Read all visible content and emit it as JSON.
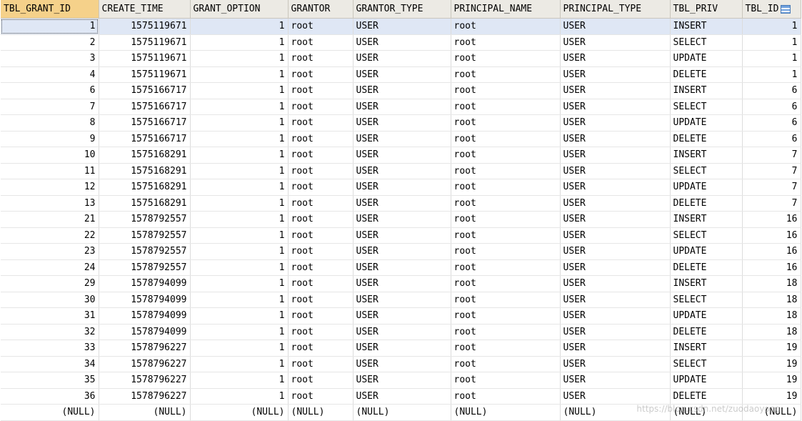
{
  "columns": [
    "TBL_GRANT_ID",
    "CREATE_TIME",
    "GRANT_OPTION",
    "GRANTOR",
    "GRANTOR_TYPE",
    "PRINCIPAL_NAME",
    "PRINCIPAL_TYPE",
    "TBL_PRIV",
    "TBL_ID"
  ],
  "rows": [
    [
      "1",
      "1575119671",
      "1",
      "root",
      "USER",
      "root",
      "USER",
      "INSERT",
      "1"
    ],
    [
      "2",
      "1575119671",
      "1",
      "root",
      "USER",
      "root",
      "USER",
      "SELECT",
      "1"
    ],
    [
      "3",
      "1575119671",
      "1",
      "root",
      "USER",
      "root",
      "USER",
      "UPDATE",
      "1"
    ],
    [
      "4",
      "1575119671",
      "1",
      "root",
      "USER",
      "root",
      "USER",
      "DELETE",
      "1"
    ],
    [
      "6",
      "1575166717",
      "1",
      "root",
      "USER",
      "root",
      "USER",
      "INSERT",
      "6"
    ],
    [
      "7",
      "1575166717",
      "1",
      "root",
      "USER",
      "root",
      "USER",
      "SELECT",
      "6"
    ],
    [
      "8",
      "1575166717",
      "1",
      "root",
      "USER",
      "root",
      "USER",
      "UPDATE",
      "6"
    ],
    [
      "9",
      "1575166717",
      "1",
      "root",
      "USER",
      "root",
      "USER",
      "DELETE",
      "6"
    ],
    [
      "10",
      "1575168291",
      "1",
      "root",
      "USER",
      "root",
      "USER",
      "INSERT",
      "7"
    ],
    [
      "11",
      "1575168291",
      "1",
      "root",
      "USER",
      "root",
      "USER",
      "SELECT",
      "7"
    ],
    [
      "12",
      "1575168291",
      "1",
      "root",
      "USER",
      "root",
      "USER",
      "UPDATE",
      "7"
    ],
    [
      "13",
      "1575168291",
      "1",
      "root",
      "USER",
      "root",
      "USER",
      "DELETE",
      "7"
    ],
    [
      "21",
      "1578792557",
      "1",
      "root",
      "USER",
      "root",
      "USER",
      "INSERT",
      "16"
    ],
    [
      "22",
      "1578792557",
      "1",
      "root",
      "USER",
      "root",
      "USER",
      "SELECT",
      "16"
    ],
    [
      "23",
      "1578792557",
      "1",
      "root",
      "USER",
      "root",
      "USER",
      "UPDATE",
      "16"
    ],
    [
      "24",
      "1578792557",
      "1",
      "root",
      "USER",
      "root",
      "USER",
      "DELETE",
      "16"
    ],
    [
      "29",
      "1578794099",
      "1",
      "root",
      "USER",
      "root",
      "USER",
      "INSERT",
      "18"
    ],
    [
      "30",
      "1578794099",
      "1",
      "root",
      "USER",
      "root",
      "USER",
      "SELECT",
      "18"
    ],
    [
      "31",
      "1578794099",
      "1",
      "root",
      "USER",
      "root",
      "USER",
      "UPDATE",
      "18"
    ],
    [
      "32",
      "1578794099",
      "1",
      "root",
      "USER",
      "root",
      "USER",
      "DELETE",
      "18"
    ],
    [
      "33",
      "1578796227",
      "1",
      "root",
      "USER",
      "root",
      "USER",
      "INSERT",
      "19"
    ],
    [
      "34",
      "1578796227",
      "1",
      "root",
      "USER",
      "root",
      "USER",
      "SELECT",
      "19"
    ],
    [
      "35",
      "1578796227",
      "1",
      "root",
      "USER",
      "root",
      "USER",
      "UPDATE",
      "19"
    ],
    [
      "36",
      "1578796227",
      "1",
      "root",
      "USER",
      "root",
      "USER",
      "DELETE",
      "19"
    ]
  ],
  "null_row": [
    "(NULL)",
    "(NULL)",
    "(NULL)",
    "(NULL)",
    "(NULL)",
    "(NULL)",
    "(NULL)",
    "(NULL)",
    "(NULL)"
  ],
  "watermark": "https://blog.csdn.net/zuodaoyong",
  "sort_icon": "sort-icon",
  "colors": {
    "header_bg": "#eceae4",
    "active_header_bg": "#f5d18a",
    "selected_row_bg": "#dfe7f5"
  }
}
